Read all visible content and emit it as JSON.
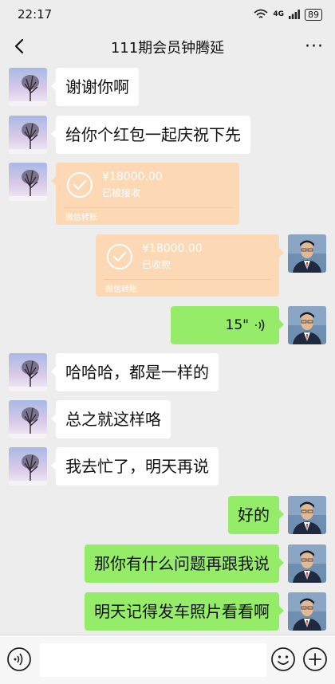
{
  "status_bar": {
    "time": "22:17",
    "network": "4G",
    "battery": "89"
  },
  "nav": {
    "title": "111期会员钟腾延",
    "more_label": "···"
  },
  "messages": [
    {
      "side": "in",
      "type": "text",
      "text": "谢谢你啊"
    },
    {
      "side": "in",
      "type": "text",
      "text": "给你个红包一起庆祝下先"
    },
    {
      "side": "in",
      "type": "transfer",
      "amount": "¥18000.00",
      "status": "已被接收",
      "label": "微信转账"
    },
    {
      "side": "out",
      "type": "transfer",
      "amount": "¥18000.00",
      "status": "已收款",
      "label": "微信转账"
    },
    {
      "side": "out",
      "type": "voice",
      "duration": "15\""
    },
    {
      "side": "in",
      "type": "text",
      "text": "哈哈哈，都是一样的"
    },
    {
      "side": "in",
      "type": "text",
      "text": "总之就这样咯"
    },
    {
      "side": "in",
      "type": "text",
      "text": "我去忙了，明天再说"
    },
    {
      "side": "out",
      "type": "text",
      "text": "好的"
    },
    {
      "side": "out",
      "type": "text",
      "text": "那你有什么问题再跟我说"
    },
    {
      "side": "out",
      "type": "text",
      "text": "明天记得发车照片看看啊"
    }
  ],
  "icons": {
    "back": "back-arrow-icon",
    "voice_input": "voice-input-icon",
    "emoji": "emoji-icon",
    "plus": "plus-icon",
    "wifi": "wifi-icon",
    "signal": "signal-icon",
    "check": "check-circle-icon",
    "voice_wave": "voice-wave-icon"
  },
  "colors": {
    "background": "#ededed",
    "incoming_bubble": "#ffffff",
    "outgoing_bubble": "#95ec69",
    "transfer_received": "#fcd8b5"
  }
}
